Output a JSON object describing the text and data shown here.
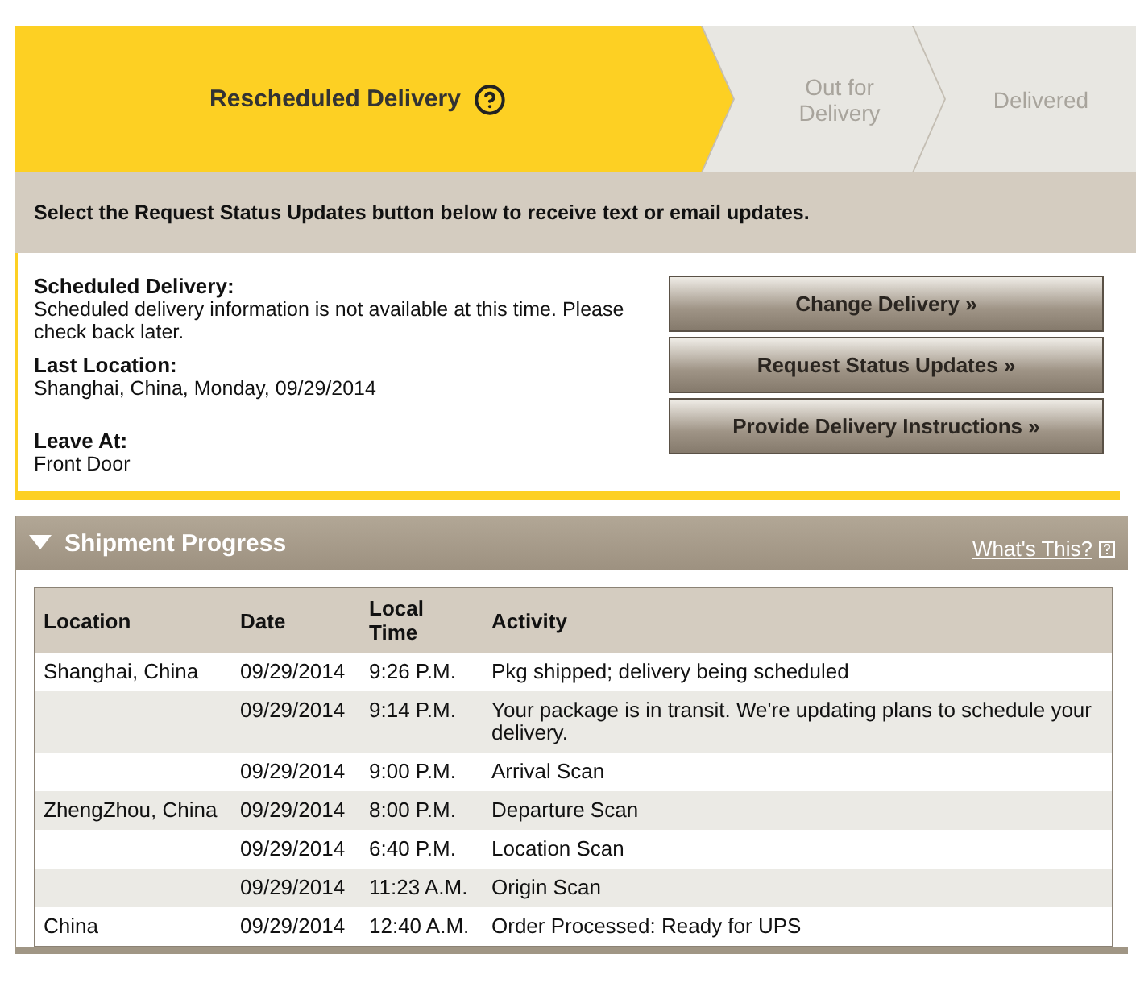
{
  "progress": {
    "steps": [
      {
        "label": "Rescheduled Delivery",
        "selected": true,
        "help": true
      },
      {
        "label": "Out for Delivery",
        "selected": false,
        "help": false
      },
      {
        "label": "Delivered",
        "selected": false,
        "help": false
      }
    ]
  },
  "notice": "Select the Request Status Updates button below to receive text or email updates.",
  "details": [
    {
      "label": "Scheduled Delivery:",
      "value": "Scheduled delivery information is not available at this time. Please check back later."
    },
    {
      "label": "Last Location:",
      "value": "Shanghai, China, Monday, 09/29/2014"
    },
    {
      "label": "Leave At:",
      "value": "Front Door"
    }
  ],
  "actions": [
    "Change Delivery »",
    "Request Status Updates »",
    "Provide Delivery Instructions »"
  ],
  "shipment_progress": {
    "title": "Shipment Progress",
    "expanded": true,
    "help_link": "What's This?",
    "columns": [
      "Location",
      "Date",
      "Local Time",
      "Activity"
    ],
    "rows": [
      [
        "Shanghai, China",
        "09/29/2014",
        "9:26 P.M.",
        "Pkg shipped; delivery being scheduled"
      ],
      [
        "",
        "09/29/2014",
        "9:14 P.M.",
        "Your package is in transit. We're updating plans to schedule your delivery."
      ],
      [
        "",
        "09/29/2014",
        "9:00 P.M.",
        "Arrival Scan"
      ],
      [
        "ZhengZhou, China",
        "09/29/2014",
        "8:00 P.M.",
        "Departure Scan"
      ],
      [
        "",
        "09/29/2014",
        "6:40 P.M.",
        "Location Scan"
      ],
      [
        "",
        "09/29/2014",
        "11:23 A.M.",
        "Origin Scan"
      ],
      [
        "China",
        "09/29/2014",
        "12:40 A.M.",
        "Order Processed: Ready for UPS"
      ]
    ]
  }
}
